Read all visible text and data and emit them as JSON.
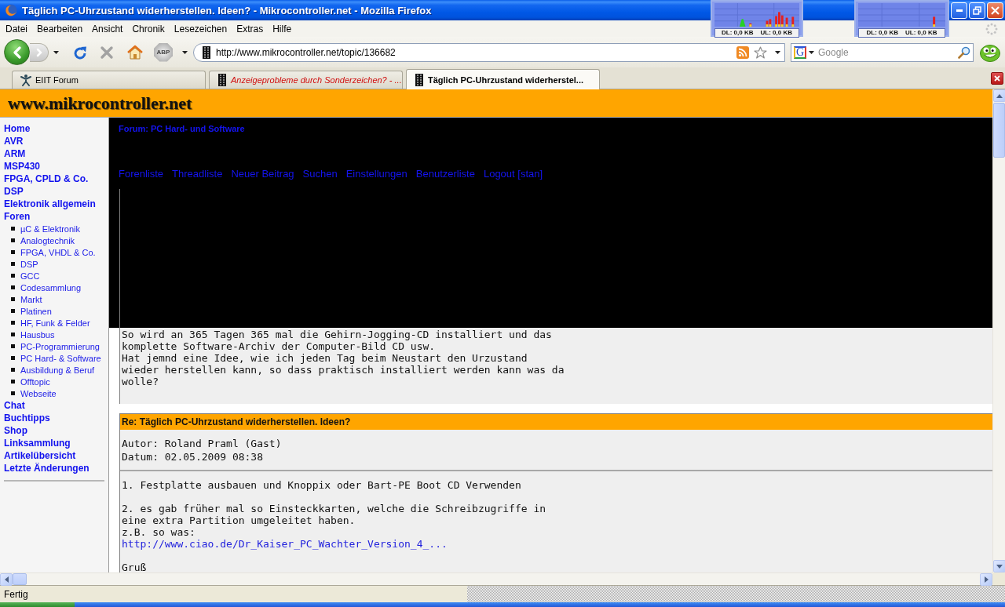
{
  "window": {
    "title": "Täglich PC-Uhrzustand widerherstellen. Ideen? - Mikrocontroller.net - Mozilla Firefox"
  },
  "traffic_meters": [
    {
      "download": "DL: 0,0 KB",
      "upload": "UL: 0,0 KB"
    },
    {
      "download": "DL: 0,0 KB",
      "upload": "UL: 0,0 KB"
    }
  ],
  "menu_bar": [
    "Datei",
    "Bearbeiten",
    "Ansicht",
    "Chronik",
    "Lesezeichen",
    "Extras",
    "Hilfe"
  ],
  "toolbar": {
    "adblock_label": "ABP",
    "address": "http://www.mikrocontroller.net/topic/136682",
    "search": {
      "engine_label": "G",
      "placeholder": "Google"
    }
  },
  "tabs": [
    {
      "label": "EIIT Forum",
      "kind": "figure",
      "selected": false,
      "unread": false
    },
    {
      "label": "Anzeigeprobleme durch Sonderzeichen? - ...",
      "kind": "chip",
      "selected": false,
      "unread": true
    },
    {
      "label": "Täglich PC-Uhrzustand widerherstel...",
      "kind": "chip",
      "selected": true,
      "unread": false
    }
  ],
  "page": {
    "site_title": "www.mikrocontroller.net",
    "sidebar": {
      "items": [
        {
          "label": "Home"
        },
        {
          "label": "AVR"
        },
        {
          "label": "ARM"
        },
        {
          "label": "MSP430"
        },
        {
          "label": "FPGA, CPLD & Co."
        },
        {
          "label": "DSP"
        },
        {
          "label": "Elektronik allgemein"
        },
        {
          "label": "Foren",
          "children": [
            {
              "label": "µC & Elektronik"
            },
            {
              "label": "Analogtechnik"
            },
            {
              "label": "FPGA, VHDL & Co."
            },
            {
              "label": "DSP"
            },
            {
              "label": "GCC"
            },
            {
              "label": "Codesammlung"
            },
            {
              "label": "Markt"
            },
            {
              "label": "Platinen"
            },
            {
              "label": "HF, Funk & Felder"
            },
            {
              "label": "Hausbus"
            },
            {
              "label": "PC-Programmierung"
            },
            {
              "label": "PC Hard- & Software"
            },
            {
              "label": "Ausbildung & Beruf"
            },
            {
              "label": "Offtopic"
            },
            {
              "label": "Webseite"
            }
          ]
        },
        {
          "label": "Chat"
        },
        {
          "label": "Buchtipps"
        },
        {
          "label": "Shop"
        },
        {
          "label": "Linksammlung"
        },
        {
          "label": "Artikelübersicht"
        },
        {
          "label": "Letzte Änderungen"
        }
      ]
    },
    "forum_header": {
      "breadcrumb": "Forum: PC Hard- und Software",
      "links": [
        "Forenliste",
        "Threadliste",
        "Neuer Beitrag",
        "Suchen",
        "Einstellungen",
        "Benutzerliste",
        "Logout [stan]"
      ]
    },
    "posts": [
      {
        "paragraphs": [
          {
            "lines": [
              "So wird an 365 Tagen 365 mal die Gehirn-Jogging-CD installiert und das",
              "komplette Software-Archiv der Computer-Bild CD usw.",
              "Hat jemnd eine Idee, wie ich jeden Tag beim Neustart den Urzustand",
              "wieder herstellen kann, so dass praktisch installiert werden kann was da",
              "wolle?"
            ]
          }
        ]
      },
      {
        "subject": "Re: Täglich PC-Uhrzustand widerherstellen. Ideen?",
        "author": "Autor: Roland Praml (Gast)",
        "date": "Datum: 02.05.2009 08:38",
        "paragraphs": [
          {
            "lines": [
              "1. Festplatte ausbauen und Knoppix oder Bart-PE Boot CD Verwenden"
            ]
          },
          {
            "lines": [
              "2. es gab früher mal so Einsteckkarten, welche die Schreibzugriffe in",
              "eine extra Partition umgeleitet haben.",
              "z.B. so was:"
            ],
            "link": "http://www.ciao.de/Dr_Kaiser_PC_Wachter_Version_4_..."
          },
          {
            "lines": [
              "Gruß"
            ]
          }
        ]
      }
    ]
  },
  "status_bar": {
    "text": "Fertig"
  }
}
